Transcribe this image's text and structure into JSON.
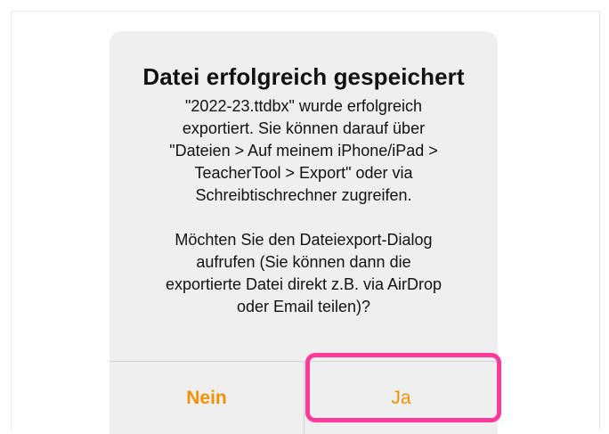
{
  "alert": {
    "title": "Datei erfolgreich gespeichert",
    "message_1": "\"2022-23.ttdbx\" wurde erfolgreich\nexportiert. Sie können darauf über\n\"Dateien > Auf meinem iPhone/iPad >\nTeacherTool > Export\" oder via\nSchreibtischrechner zugreifen.",
    "message_2": "Möchten Sie den Dateiexport-Dialog\naufrufen (Sie können dann die\nexportierte Datei direkt z.B. via AirDrop\noder Email teilen)?",
    "buttons": {
      "no_label": "Nein",
      "yes_label": "Ja"
    }
  },
  "colors": {
    "accent": "#f29100",
    "highlight": "#ff3a9a",
    "alert_background": "#efefef"
  }
}
